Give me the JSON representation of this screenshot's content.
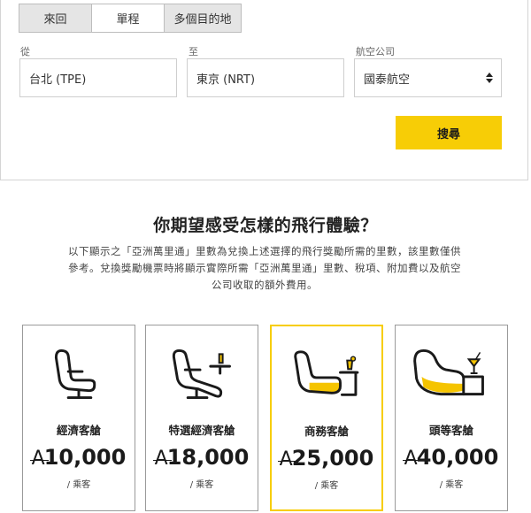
{
  "trip_tabs": [
    "來回",
    "單程",
    "多個目的地"
  ],
  "active_tab": 1,
  "form": {
    "from_label": "從",
    "from_value": "台北 (TPE)",
    "to_label": "至",
    "to_value": "東京 (NRT)",
    "airline_label": "航空公司",
    "airline_value": "國泰航空",
    "search_label": "搜尋"
  },
  "experience": {
    "heading": "你期望感受怎樣的飛行體驗？",
    "desc_lines": [
      "以下顯示之「亞洲萬里通」里數為兌換上述選擇的飛行獎勵所需的里數，該里數僅供",
      "參考。兌換獎勵機票時將顯示實際所需「亞洲萬里通」里數、稅項、附加費以及航空",
      "公司收取的額外費用。"
    ]
  },
  "cabins": [
    {
      "name": "經濟客艙",
      "currency": "A",
      "miles": "10,000",
      "per": "/ 乘客",
      "highlight": false
    },
    {
      "name": "特選經濟客艙",
      "currency": "A",
      "miles": "18,000",
      "per": "/ 乘客",
      "highlight": false
    },
    {
      "name": "商務客艙",
      "currency": "A",
      "miles": "25,000",
      "per": "/ 乘客",
      "highlight": true
    },
    {
      "name": "頭等客艙",
      "currency": "A",
      "miles": "40,000",
      "per": "/ 乘客",
      "highlight": false
    }
  ],
  "colors": {
    "accent": "#f7cd06",
    "seat_fill": "#f5c400"
  }
}
